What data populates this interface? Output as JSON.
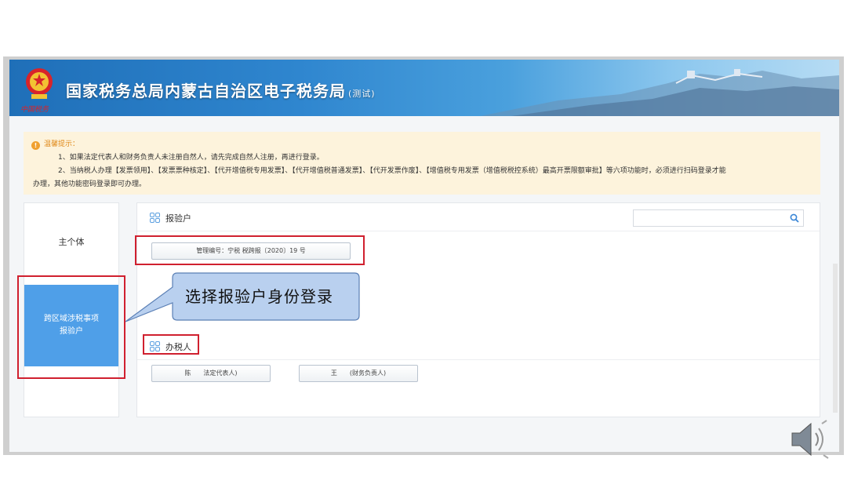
{
  "banner": {
    "title": "国家税务总局内蒙古自治区电子税务局",
    "title_suffix": "(测试)",
    "brand_script": "中国税务"
  },
  "notice": {
    "title": "温馨提示：",
    "line1": "1、如果法定代表人和财务负责人未注册自然人，请先完成自然人注册，再进行登录。",
    "line2": "2、当纳税人办理【发票领用】、【发票票种核定】、【代开增值税专用发票】、【代开增值税普通发票】、【代开发票作废】、【增值税专用发票（增值税税控系统）最高开票限额审批】等六项功能时，必须进行扫码登录才能",
    "line3": "办理，其他功能密码登录即可办理。"
  },
  "left_tabs": {
    "main": "主个体",
    "cross_line1": "跨区域涉税事项",
    "cross_line2": "报验户"
  },
  "sections": {
    "inspection": {
      "title": "报验户",
      "item": "管理编号：宁税 税跨报〔2020〕19 号"
    },
    "taxpayer": {
      "title": "办税人",
      "legal_rep": "陈　　法定代表人)",
      "finance_head": "王　　(财务负责人)"
    }
  },
  "search": {
    "placeholder": ""
  },
  "callout": {
    "text": "选择报验户身份登录"
  },
  "colors": {
    "banner_blue": "#2f86cf",
    "tab_active": "#4f9fe8",
    "highlight_red": "#d0202f",
    "notice_bg": "#fdf3dc",
    "callout_fill": "#b9d0ef"
  }
}
